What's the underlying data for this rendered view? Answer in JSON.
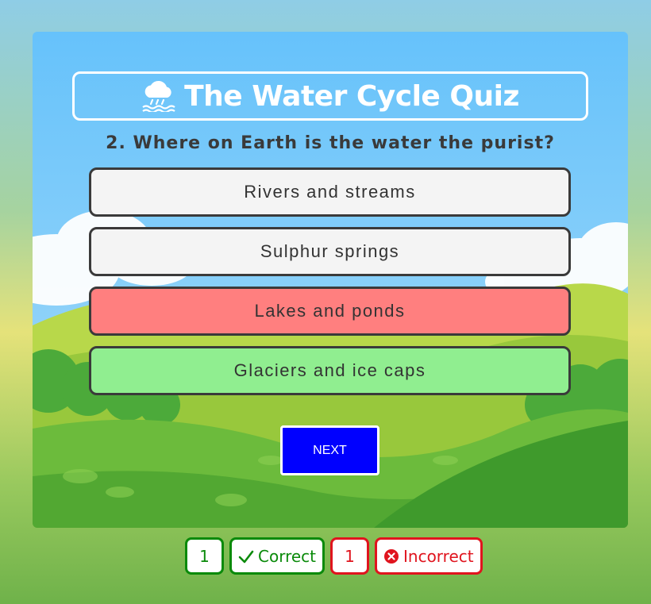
{
  "quiz": {
    "title": "The Water Cycle Quiz",
    "title_icon": "cloud-rain-icon",
    "question": "2. Where on Earth is the water the purist?",
    "answers": [
      {
        "label": "Rivers and streams",
        "state": "neutral",
        "color": "#f4f4f4"
      },
      {
        "label": "Sulphur springs",
        "state": "neutral",
        "color": "#f4f4f4"
      },
      {
        "label": "Lakes and ponds",
        "state": "incorrect",
        "color": "#ff7f7f"
      },
      {
        "label": "Glaciers and ice caps",
        "state": "correct",
        "color": "#90ee90"
      }
    ],
    "next_label": "NEXT"
  },
  "score": {
    "correct_count": "1",
    "correct_label": "Correct",
    "correct_icon": "checkmark-icon",
    "incorrect_count": "1",
    "incorrect_label": "Incorrect",
    "incorrect_icon": "x-circle-icon"
  },
  "colors": {
    "accent": "#0000ff",
    "correct": "#0a8a0a",
    "incorrect": "#e0141e"
  }
}
